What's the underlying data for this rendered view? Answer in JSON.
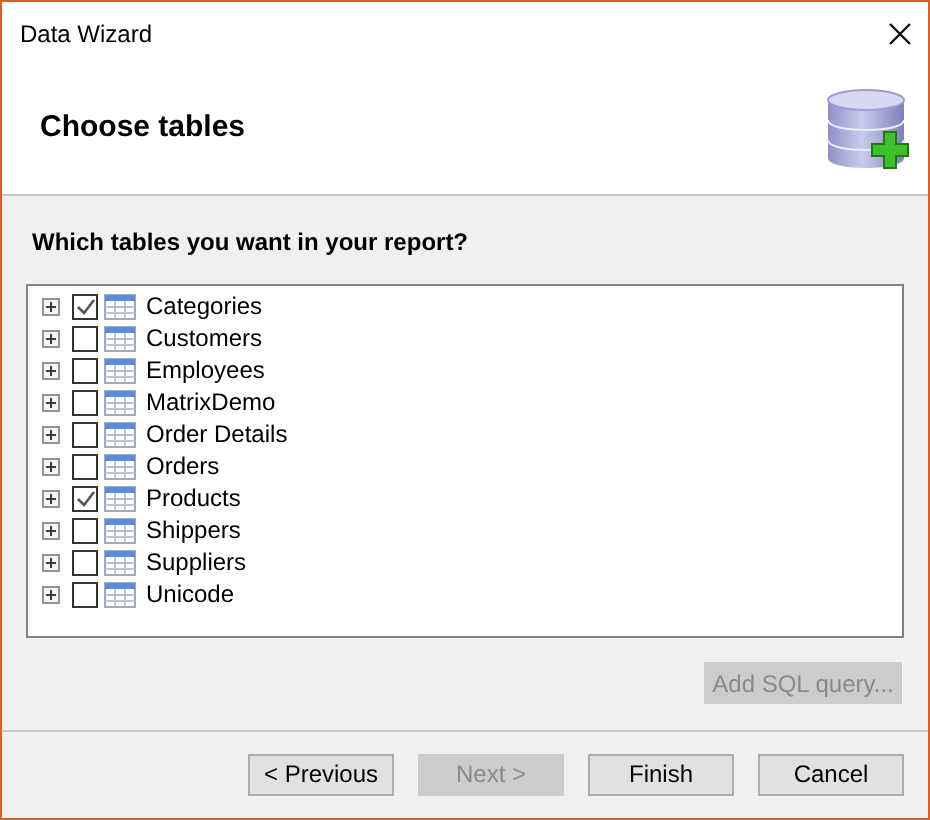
{
  "window": {
    "title": "Data Wizard"
  },
  "header": {
    "title": "Choose tables"
  },
  "prompt": "Which tables you want in your report?",
  "tables": [
    {
      "label": "Categories",
      "checked": true,
      "expanded": false
    },
    {
      "label": "Customers",
      "checked": false,
      "expanded": false
    },
    {
      "label": "Employees",
      "checked": false,
      "expanded": false
    },
    {
      "label": "MatrixDemo",
      "checked": false,
      "expanded": false
    },
    {
      "label": "Order Details",
      "checked": false,
      "expanded": false
    },
    {
      "label": "Orders",
      "checked": false,
      "expanded": false
    },
    {
      "label": "Products",
      "checked": true,
      "expanded": false
    },
    {
      "label": "Shippers",
      "checked": false,
      "expanded": false
    },
    {
      "label": "Suppliers",
      "checked": false,
      "expanded": false
    },
    {
      "label": "Unicode",
      "checked": false,
      "expanded": false
    }
  ],
  "add_sql_button": {
    "label": "Add SQL query...",
    "disabled": true
  },
  "buttons": [
    {
      "label": "< Previous",
      "disabled": false
    },
    {
      "label": "Next >",
      "disabled": true
    },
    {
      "label": "Finish",
      "disabled": false
    },
    {
      "label": "Cancel",
      "disabled": false
    }
  ]
}
